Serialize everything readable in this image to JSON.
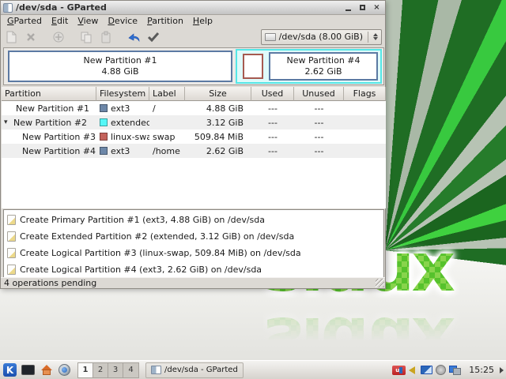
{
  "window": {
    "title": "/dev/sda - GParted",
    "titlebar_buttons": {
      "minimize": "",
      "maximize": "",
      "close": "×"
    },
    "menu": [
      "GParted",
      "Edit",
      "View",
      "Device",
      "Partition",
      "Help"
    ],
    "toolbar": {
      "device_selector": "/dev/sda  (8.00 GiB)"
    },
    "visual_bar": {
      "partition1": {
        "line1": "New Partition #1",
        "line2": "4.88 GiB"
      },
      "partition4": {
        "line1": "New Partition #4",
        "line2": "2.62 GiB"
      }
    },
    "table": {
      "headers": [
        "Partition",
        "Filesystem",
        "Label",
        "Size",
        "Used",
        "Unused",
        "Flags"
      ],
      "rows": [
        {
          "expander": "",
          "partition": "New Partition #1",
          "fs": "ext3",
          "fs_color": "#6d87a8",
          "label": "/",
          "size": "4.88 GiB",
          "used": "---",
          "unused": "---",
          "flags": ""
        },
        {
          "expander": "▾",
          "partition": "New Partition #2",
          "fs": "extended",
          "fs_color": "#55f7f7",
          "label": "",
          "size": "3.12 GiB",
          "used": "---",
          "unused": "---",
          "flags": ""
        },
        {
          "expander": "",
          "partition": "New Partition #3",
          "fs": "linux-swap",
          "fs_color": "#c4635c",
          "label": "swap",
          "size": "509.84 MiB",
          "used": "---",
          "unused": "---",
          "flags": ""
        },
        {
          "expander": "",
          "partition": "New Partition #4",
          "fs": "ext3",
          "fs_color": "#6d87a8",
          "label": "/home",
          "size": "2.62 GiB",
          "used": "---",
          "unused": "---",
          "flags": ""
        }
      ]
    },
    "operations": [
      "Create Primary Partition #1 (ext3, 4.88 GiB) on /dev/sda",
      "Create Extended Partition #2 (extended, 3.12 GiB) on /dev/sda",
      "Create Logical Partition #3 (linux-swap, 509.84 MiB) on /dev/sda",
      "Create Logical Partition #4 (ext3, 2.62 GiB) on /dev/sda"
    ],
    "statusbar": "4 operations pending"
  },
  "taskbar": {
    "kmenu_glyph": "K",
    "pager": [
      "1",
      "2",
      "3",
      "4"
    ],
    "active_workspace": "1",
    "task_label": "/dev/sda - GParted",
    "keyboard_layout": "us",
    "clock": "15:25"
  },
  "desktop": {
    "logo_text": "sidux"
  },
  "colors": {
    "ext3": "#6d87a8",
    "extended": "#55f7f7",
    "linux_swap": "#c4635c",
    "partition_border": "#5c7aa3",
    "extended_border": "#55e7e7",
    "swap_border": "#a65a50",
    "logo_green": "#56c22c",
    "ray_dark_green": "#1f6d24",
    "ray_bright_green": "#3fd13f"
  }
}
